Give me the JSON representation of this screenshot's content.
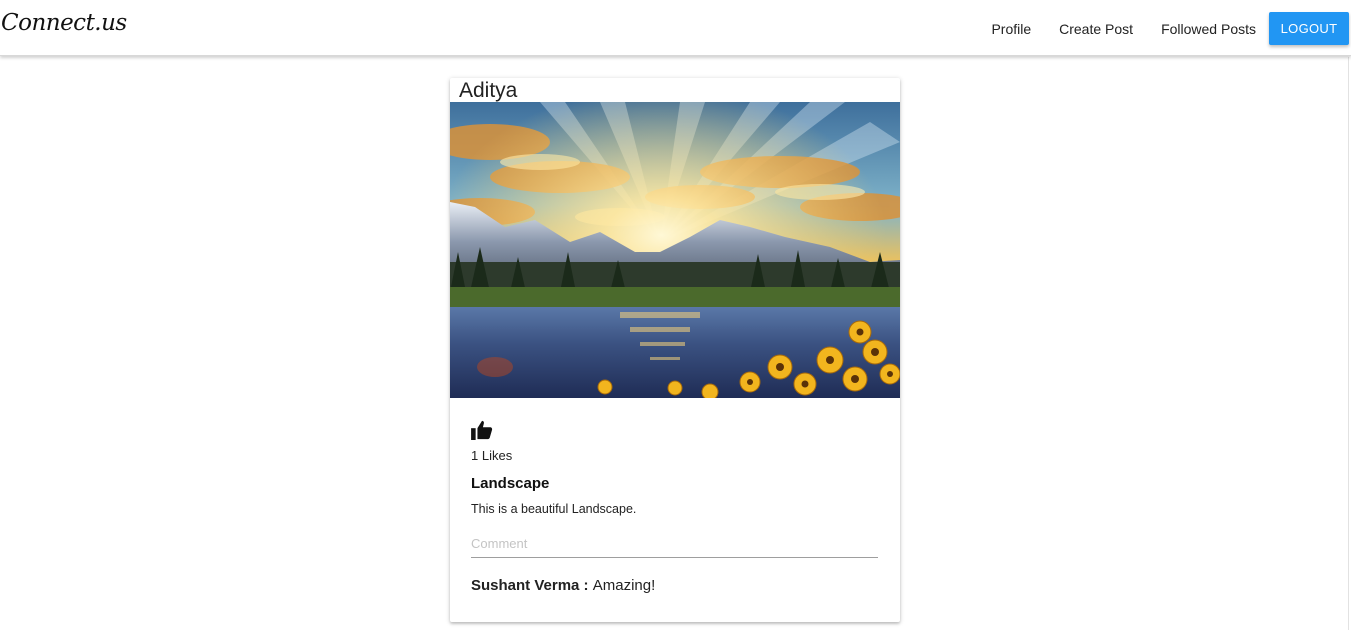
{
  "brand": "Connect.us",
  "nav": {
    "profile": "Profile",
    "create_post": "Create Post",
    "followed_posts": "Followed Posts",
    "logout": "LOGOUT"
  },
  "colors": {
    "accent": "#2196f3"
  },
  "post": {
    "author": "Aditya",
    "image": "landscape-photo",
    "like_icon": "thumbs-up-icon",
    "likes": "1 Likes",
    "title": "Landscape",
    "body": "This is a beautiful Landscape.",
    "comment_placeholder": "Comment",
    "comments": [
      {
        "author": "Sushant Verma",
        "separator": " : ",
        "text": "Amazing!"
      }
    ]
  }
}
